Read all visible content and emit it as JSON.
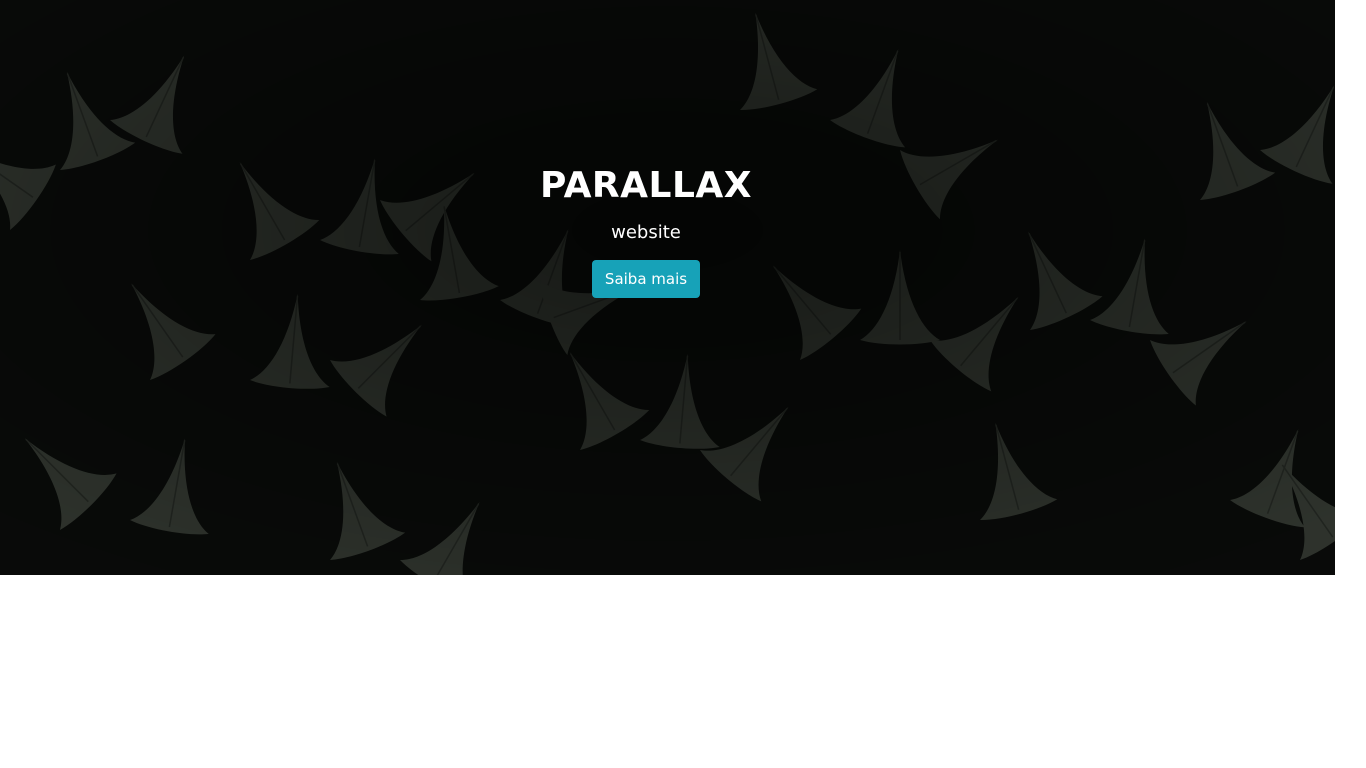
{
  "hero": {
    "title": "PARALLAX",
    "subtitle": "website",
    "button_label": "Saiba mais",
    "button_color": "#17a2b8",
    "background_image": "dark-green-leaves-with-raindrops"
  },
  "colors": {
    "page_background": "#ffffff",
    "hero_overlay": "#050605",
    "leaf_fill": "#3a3f38",
    "text": "#ffffff"
  }
}
